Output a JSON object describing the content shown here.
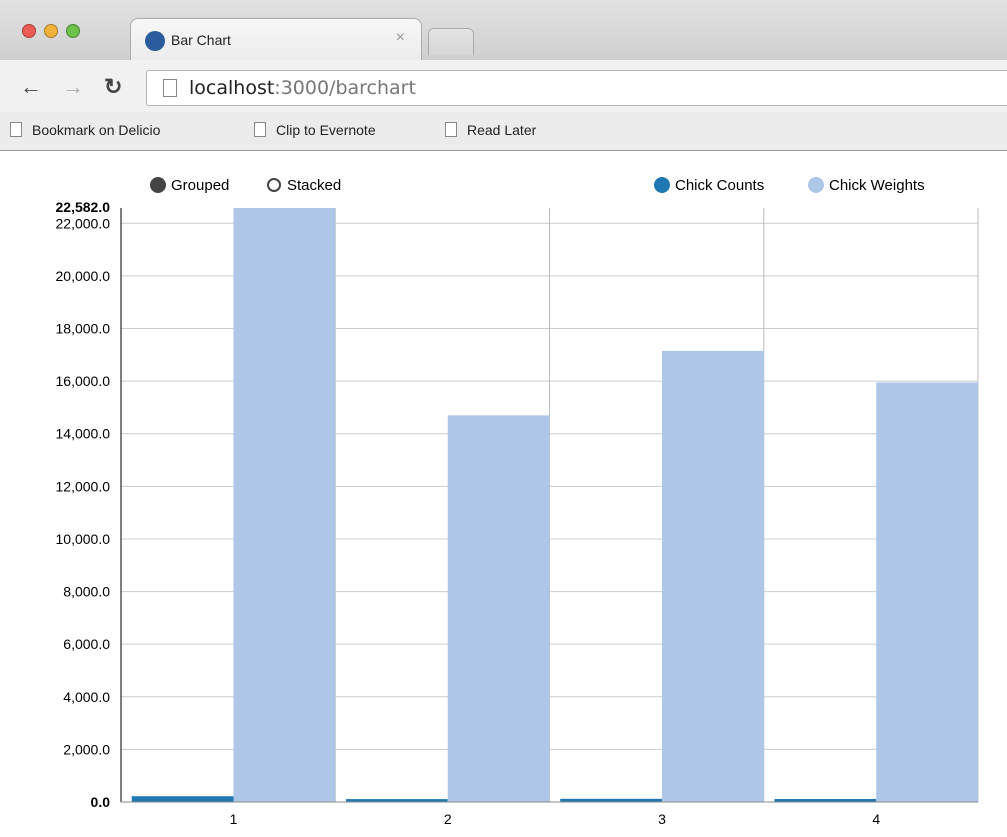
{
  "browser": {
    "tab_title": "Bar Chart",
    "tab_close": "×",
    "url_host": "localhost",
    "url_path": ":3000/barchart",
    "bookmarks": [
      "Bookmark on Delicio",
      "Clip to Evernote",
      "Read Later"
    ]
  },
  "controls": {
    "grouped_label": "Grouped",
    "stacked_label": "Stacked",
    "selected": "Grouped"
  },
  "colors": {
    "chick_counts": "#1f77b4",
    "chick_weights": "#aec7e8",
    "grid": "#cccccc"
  },
  "chart_data": {
    "type": "bar",
    "mode": "grouped",
    "categories": [
      "1",
      "2",
      "3",
      "4"
    ],
    "series": [
      {
        "name": "Chick Counts",
        "values": [
          220,
          110,
          120,
          115
        ]
      },
      {
        "name": "Chick Weights",
        "values": [
          22582,
          14700,
          17150,
          15950
        ]
      }
    ],
    "ylim": [
      0,
      22582
    ],
    "y_max_label": "22,582.0",
    "y_ticks": [
      "0.0",
      "2,000.0",
      "4,000.0",
      "6,000.0",
      "8,000.0",
      "10,000.0",
      "12,000.0",
      "14,000.0",
      "16,000.0",
      "18,000.0",
      "20,000.0",
      "22,000.0"
    ],
    "legend_position": "top-right",
    "grid": true
  }
}
